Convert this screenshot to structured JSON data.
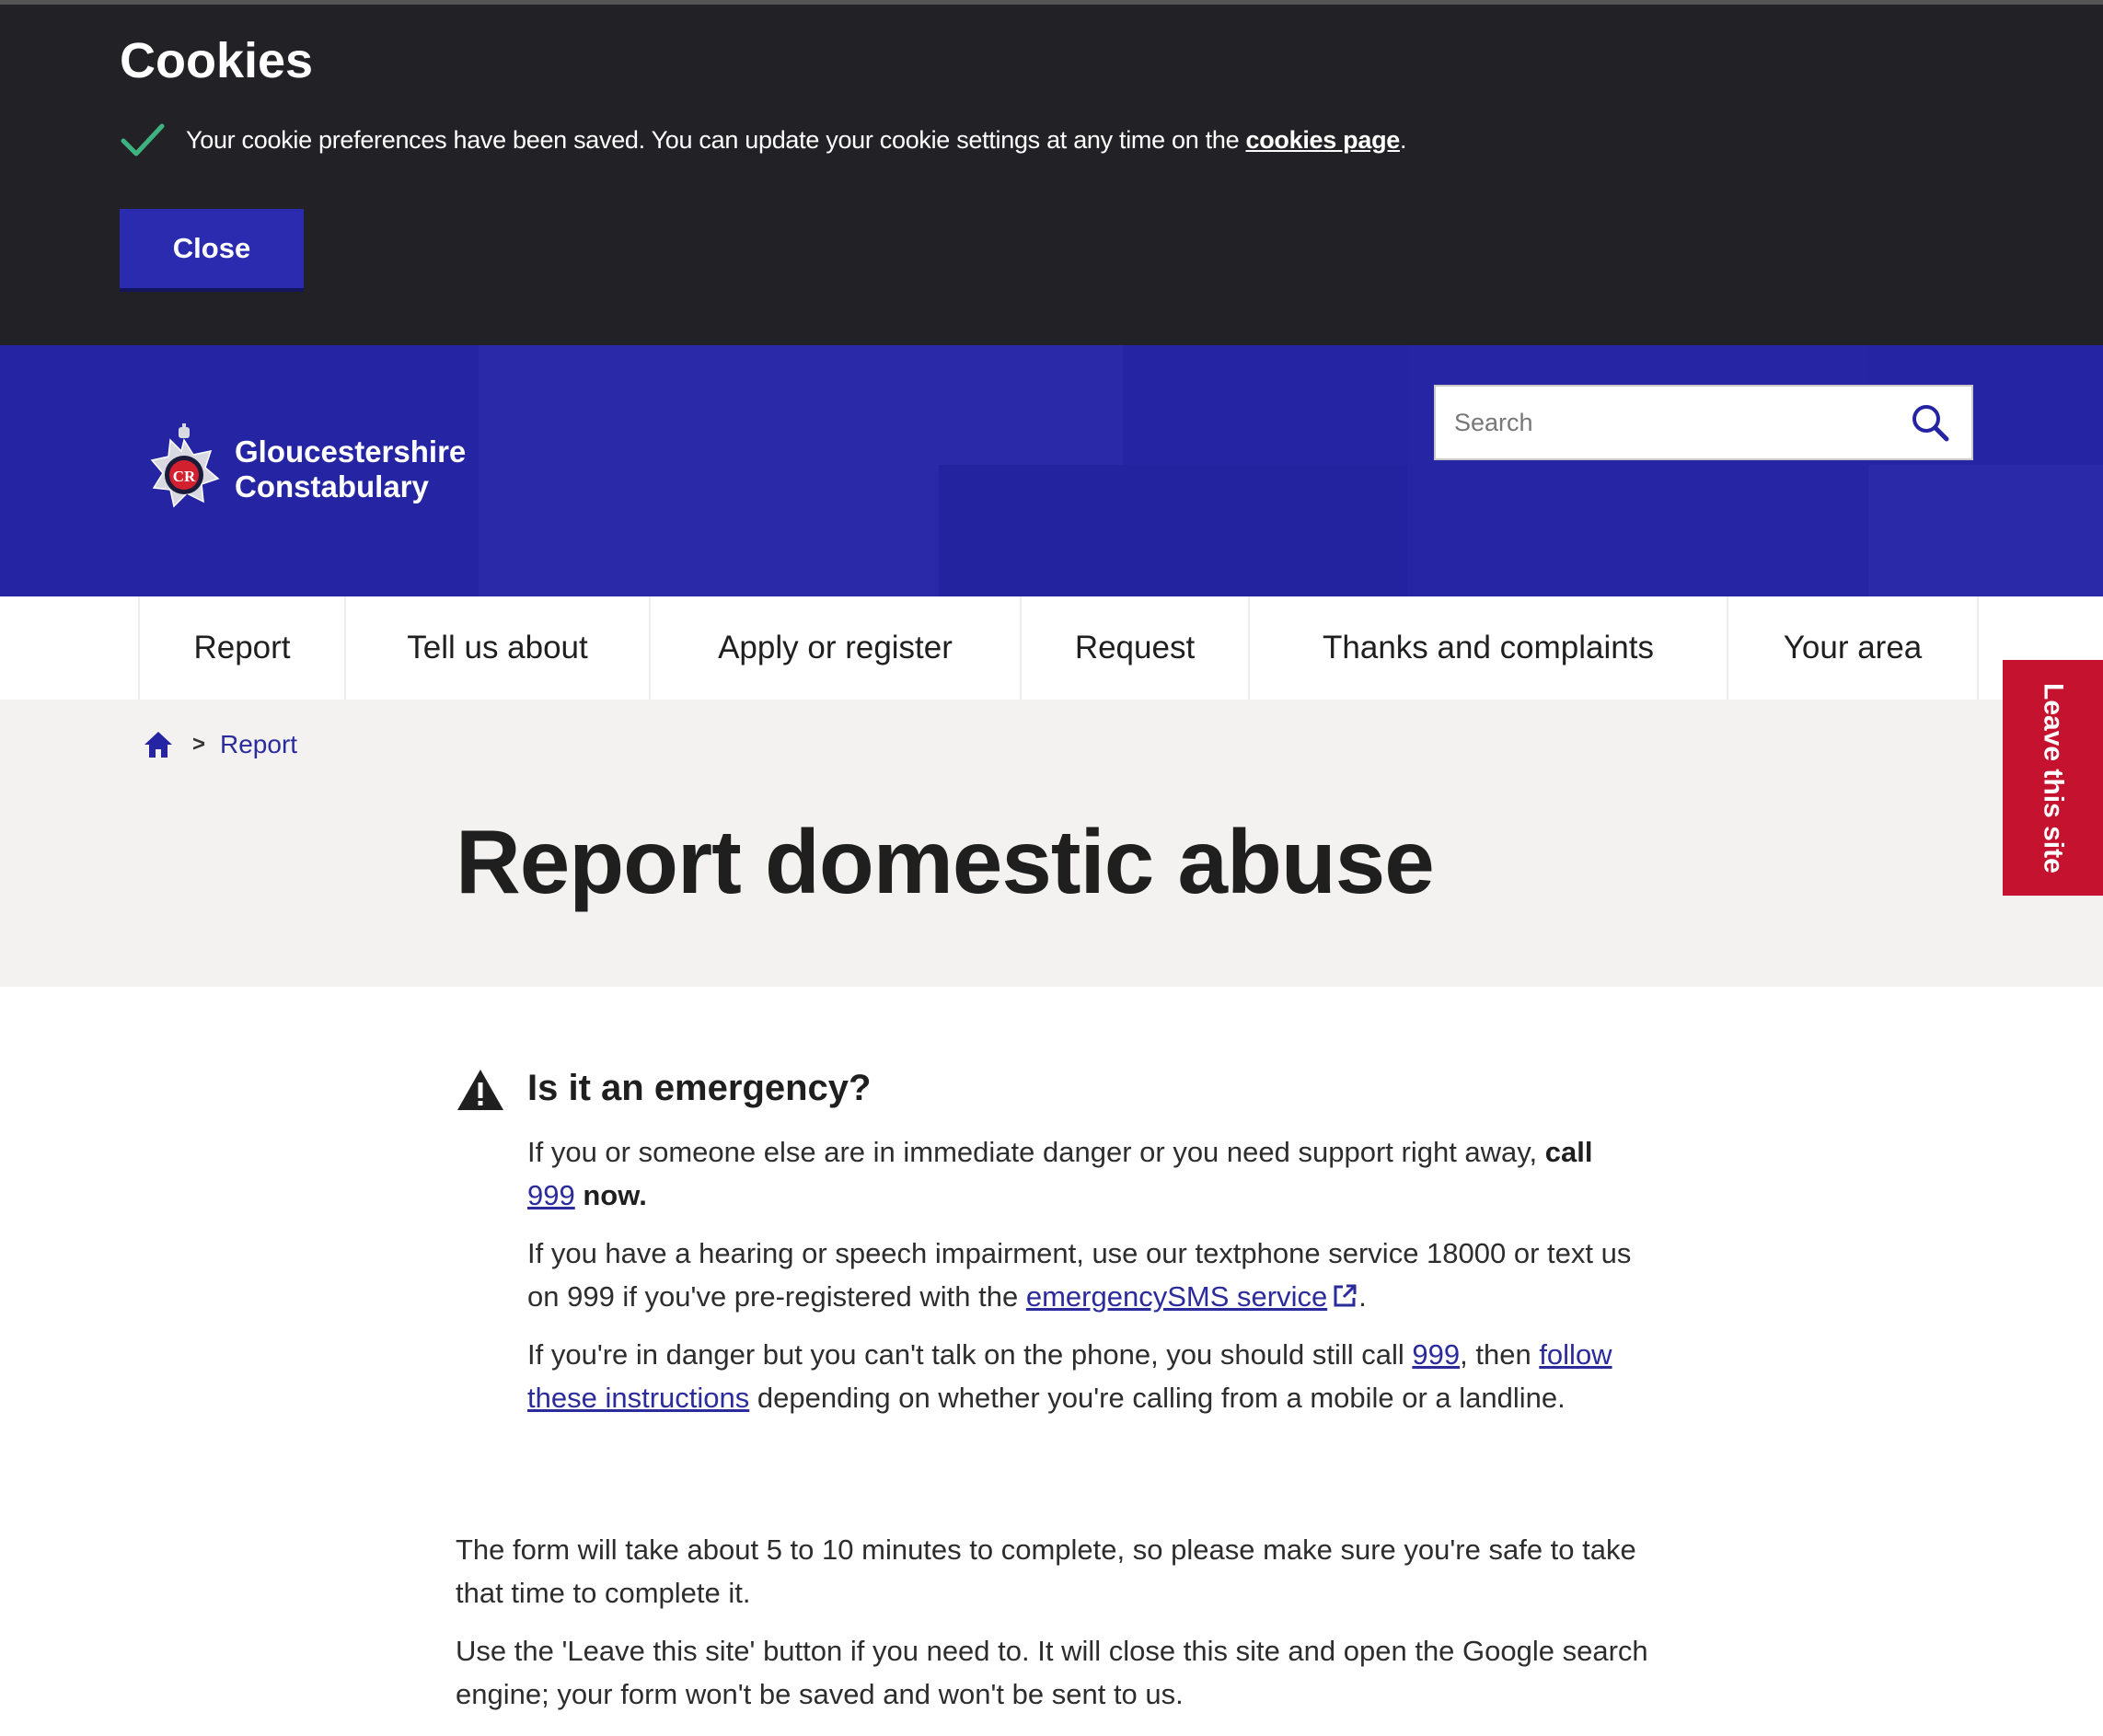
{
  "cookies": {
    "title": "Cookies",
    "message": "Your cookie preferences have been saved. You can update your cookie settings at any time on the",
    "link_text": "cookies page",
    "period": ".",
    "close_label": "Close"
  },
  "header": {
    "logo_line1": "Gloucestershire",
    "logo_line2": "Constabulary",
    "search_placeholder": "Search"
  },
  "nav": {
    "items": [
      "Report",
      "Tell us about",
      "Apply or register",
      "Request",
      "Thanks and complaints",
      "Your area"
    ]
  },
  "breadcrumb": {
    "current": "Report",
    "separator": ">"
  },
  "page": {
    "title": "Report domestic abuse"
  },
  "leave_site": {
    "label": "Leave this site"
  },
  "emergency": {
    "title": "Is it an emergency?",
    "p1": {
      "text": "If you or someone else are in immediate danger or you need support right away,",
      "bold": "call",
      "link": "999",
      "tail": "now."
    },
    "p2": {
      "text": "If you have a hearing or speech impairment, use our textphone service 18000 or text us on 999 if you've pre-registered with the",
      "link": "emergencySMS service",
      "tail": "."
    },
    "p3": {
      "text": "If you're in danger but you can't talk on the phone, you should still call",
      "link": "999",
      "mid": ", then",
      "link2": "follow these instructions",
      "tail": "depending on whether you're calling from a mobile or a landline."
    }
  },
  "info": {
    "p1": "The form will take about 5 to 10 minutes to complete, so please make sure you're safe to take that time to complete it.",
    "p2": "Use the 'Leave this site' button if you need to. It will close this site and open the Google search engine; your form won't be saved and won't be sent to us."
  },
  "colors": {
    "header_blue": "#2525a3",
    "banner_dark": "#222226",
    "leave_red": "#c4122f",
    "link_blue": "#2b2b9c",
    "check_green": "#3fb37f"
  },
  "icons": [
    "check-icon",
    "crest-icon",
    "search-icon",
    "home-icon",
    "warning-icon",
    "external-link-icon"
  ]
}
